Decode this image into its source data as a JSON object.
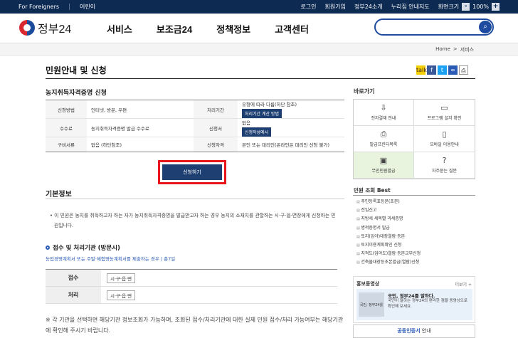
{
  "topbar": {
    "foreigners": "For Foreigners",
    "kids": "어린이",
    "login": "로그인",
    "join": "회원가입",
    "about": "정부24소개",
    "guide": "누리집 안내지도",
    "zoom_label": "화면크기",
    "zoom_minus": "-",
    "zoom_value": "100%",
    "zoom_plus": "+"
  },
  "header": {
    "logo": "정부24",
    "nav": [
      "서비스",
      "보조금24",
      "정책정보",
      "고객센터"
    ],
    "search_placeholder": ""
  },
  "breadcrumb": {
    "home": "Home",
    "sep": ">",
    "current": "서비스"
  },
  "page": {
    "title": "민원안내 및 신청",
    "subtitle": "농지취득자격증명 신청"
  },
  "info": {
    "method_h": "신청방법",
    "method": "인터넷, 방문, 우편",
    "period_h": "처리기간",
    "period": "유형에 따라 다름(하단 참조)",
    "period_btn": "처리기간 계산 방법",
    "fee_h": "수수료",
    "fee": "농지취득자격증명 발급 수수료",
    "form_h": "신청서",
    "form": "없음",
    "form_btn": "신청작성예시",
    "docs_h": "구비서류",
    "docs": "없음 (하단참조)",
    "qual_h": "신청자격",
    "qual": "본인 또는 대리인(온라인은 대리인 신청 불가)"
  },
  "apply_btn": "신청하기",
  "basic": {
    "title": "기본정보",
    "desc1": "• 이 민원은 농지를 취득하고자 하는 자가 농지취득자격증명을 발급받고자 하는 경우 농지의 소재지를 관할하는 시·구·읍·면장에게 신청하는 민",
    "desc2": "원입니다."
  },
  "visit": {
    "title": "접수 및 처리기관 (방문시)",
    "link": "농업경영계획서 또는 주말·체험영농계획서를 제출하는 경우 | 총7일",
    "rows": [
      {
        "h": "접수",
        "v": "시·구·읍·면"
      },
      {
        "h": "처리",
        "v": "시·구·읍·면"
      }
    ]
  },
  "note": "※ 각 기관을 선택하면 해당기관 정보조회가 가능하며, 조회된 접수/처리기관에 대한 실제 민원 접수/처리 가능여부는 해당기관에 확인해 주시기 바랍니다.",
  "side": {
    "title": "바로가기",
    "quick": [
      {
        "icon": "⇩",
        "label": "전자결재 안내"
      },
      {
        "icon": "▭",
        "label": "프로그램 설치 확인"
      },
      {
        "icon": "⎙",
        "label": "발급프린터목록"
      },
      {
        "icon": "▯",
        "label": "모바일 이용안내"
      },
      {
        "icon": "▣",
        "label": "무인민원발급"
      },
      {
        "icon": "?",
        "label": "자주묻는 질문"
      }
    ],
    "best_title": "민원 조회 Best",
    "best": [
      "주민등록표등본(초본)",
      "전입신고",
      "지방세 세목별 과세증명",
      "병적증명서 발급",
      "토지(임야)대장열람·등본",
      "토지이용계획확인 신청",
      "지적도(임야도)열람·등본교부신청",
      "건축물대장등초본발급(열람)신청"
    ],
    "promo_title": "홍보동영상",
    "promo_more": "더보기 +",
    "promo_img": "국민, 정부24를",
    "promo_head": "국민, 정부24를 말하다.",
    "promo_sub": "국민이 말하는 정부24의 편리한 점을 동영상으로 확인해 보세요.",
    "cert": "공동인증서",
    "cert_suffix": "안내"
  }
}
